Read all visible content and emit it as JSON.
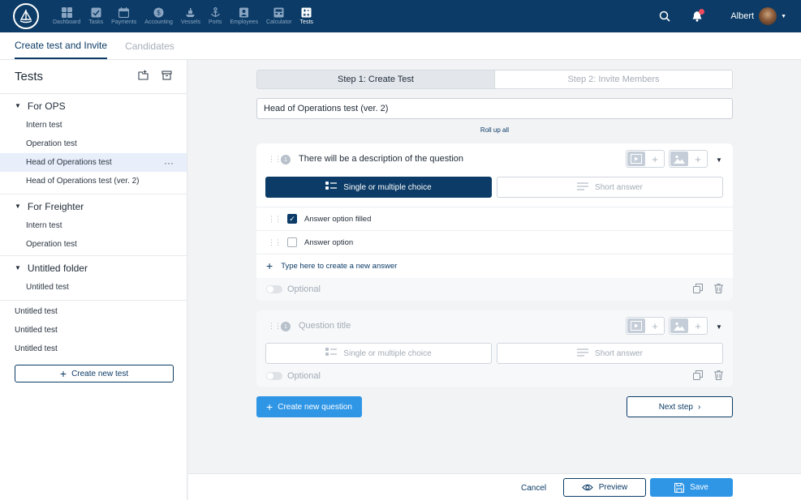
{
  "nav": {
    "items": [
      {
        "label": "Dashboard",
        "icon": "grid-icon"
      },
      {
        "label": "Tasks",
        "icon": "checkbox-icon"
      },
      {
        "label": "Payments",
        "icon": "calendar-icon"
      },
      {
        "label": "Accounting",
        "icon": "dollar-icon"
      },
      {
        "label": "Vessels",
        "icon": "ship-icon"
      },
      {
        "label": "Ports",
        "icon": "anchor-icon"
      },
      {
        "label": "Employees",
        "icon": "id-card-icon"
      },
      {
        "label": "Calculator",
        "icon": "calculator-icon"
      },
      {
        "label": "Tests",
        "icon": "tests-icon"
      }
    ],
    "active": "Tests",
    "user_name": "Albert",
    "accent": "#0b3b66"
  },
  "tabs": [
    "Create test and Invite",
    "Candidates"
  ],
  "sidebar": {
    "title": "Tests",
    "folders": [
      {
        "name": "For OPS",
        "items": [
          "Intern test",
          "Operation test",
          "Head of Operations test",
          "Head of Operations test (ver. 2)"
        ]
      },
      {
        "name": "For Freighter",
        "items": [
          "Intern test",
          "Operation test"
        ]
      },
      {
        "name": "Untitled folder",
        "items": [
          "Untitled test"
        ]
      }
    ],
    "loose": [
      "Untitled test",
      "Untitled test",
      "Untitled test"
    ],
    "create_label": "Create new test",
    "more_glyph": "···"
  },
  "steps": [
    "Step 1: Create Test",
    "Step 2: Invite Members"
  ],
  "test_title": "Head of Operations test (ver. 2)",
  "rollup": "Roll up all",
  "q1": {
    "number": "1",
    "title": "There will be a description of the question",
    "type_choice": "Single or multiple choice",
    "type_short": "Short answer",
    "answers": [
      "Answer option filled",
      "Answer option"
    ],
    "answers_checked": [
      true,
      false
    ],
    "add_answer": "Type here to create a new answer",
    "optional": "Optional"
  },
  "q2": {
    "number": "1",
    "title": "Question title",
    "type_choice": "Single or multiple choice",
    "type_short": "Short answer",
    "optional": "Optional"
  },
  "create_question": "Create new question",
  "next_step": "Next step",
  "footer": {
    "cancel": "Cancel",
    "preview": "Preview",
    "save": "Save"
  }
}
